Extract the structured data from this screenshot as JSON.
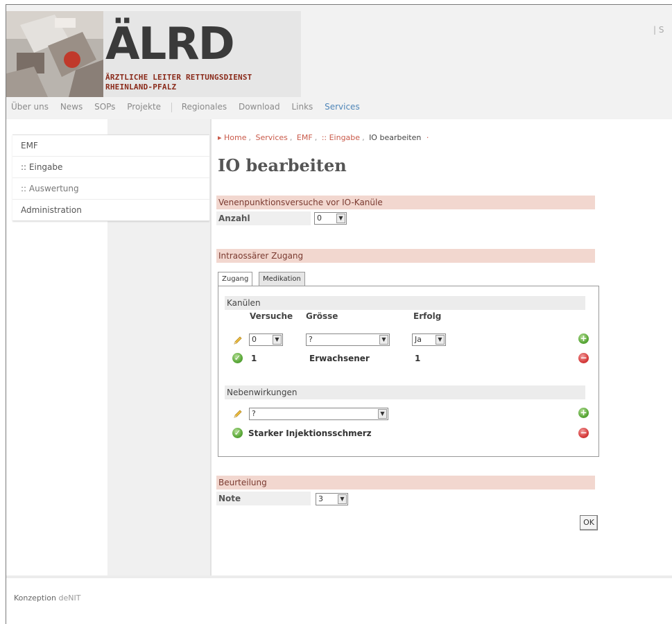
{
  "header": {
    "logo_text": "ÄLRD",
    "logo_line1": "ÄRZTLICHE LEITER RETTUNGSDIENST",
    "logo_line2": "RHEINLAND-PFALZ",
    "topright": "| S"
  },
  "topnav": [
    "Über uns",
    "News",
    "SOPs",
    "Projekte",
    "Regionales",
    "Download",
    "Links",
    "Services"
  ],
  "sidebar": {
    "items": [
      {
        "label": "EMF"
      },
      {
        "label": ":: Eingabe"
      },
      {
        "label": ":: Auswertung"
      },
      {
        "label": "Administration"
      }
    ]
  },
  "breadcrumb": [
    "Home",
    "Services",
    "EMF",
    ":: Eingabe",
    "IO bearbeiten"
  ],
  "page_title": "IO bearbeiten",
  "venen": {
    "title": "Venenpunktionsversuche vor IO-Kanüle",
    "label": "Anzahl",
    "value": "0"
  },
  "zugang": {
    "title": "Intraossärer Zugang",
    "tabs": [
      "Zugang",
      "Medikation"
    ],
    "kanuelen": {
      "title": "Kanülen",
      "headers": [
        "Versuche",
        "Grösse",
        "Erfolg"
      ],
      "input": {
        "versuche": "0",
        "groesse": "?",
        "erfolg": "Ja"
      },
      "row": {
        "versuche": "1",
        "groesse": "Erwachsener",
        "erfolg": "1"
      }
    },
    "nebenwirkungen": {
      "title": "Nebenwirkungen",
      "input": "?",
      "row": "Starker Injektionsschmerz"
    }
  },
  "beurteilung": {
    "title": "Beurteilung",
    "label": "Note",
    "value": "3"
  },
  "ok_label": "OK",
  "footer": {
    "text": "Konzeption",
    "brand": "deNIT"
  },
  "colors": {
    "section_bg": "#f2d7cf",
    "link": "#c95a4a",
    "active_nav": "#4f86b8",
    "logo_red": "#8a2a1a"
  }
}
